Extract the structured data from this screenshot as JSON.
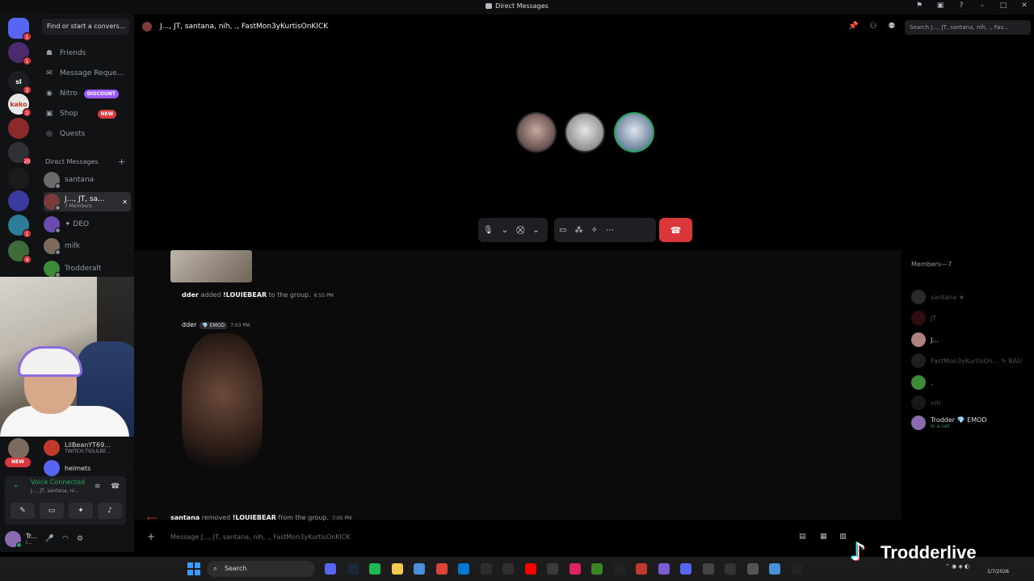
{
  "window": {
    "title": "Direct Messages"
  },
  "guilds": {
    "items": [
      {
        "name": "discord-home",
        "color": "#5865f2",
        "badge": "1",
        "label": ""
      },
      {
        "name": "guild-1",
        "color": "#4a2c6e",
        "badge": "1",
        "label": ""
      },
      {
        "name": "guild-2",
        "color": "#1e1f22",
        "badge": "3",
        "label": "sl"
      },
      {
        "name": "guild-3",
        "color": "#e8e8e8",
        "badge": "2",
        "label": "kako"
      },
      {
        "name": "guild-4",
        "color": "#8a2a2a",
        "badge": "",
        "label": ""
      },
      {
        "name": "guild-5",
        "color": "#2f3136",
        "badge": "20",
        "label": ""
      },
      {
        "name": "guild-6",
        "color": "#1b1b1b",
        "badge": "",
        "label": ""
      },
      {
        "name": "guild-7",
        "color": "#3a3aa0",
        "badge": "",
        "label": ""
      },
      {
        "name": "guild-8",
        "color": "#2d7d9a",
        "badge": "1",
        "label": ""
      },
      {
        "name": "guild-9",
        "color": "#3f6b3a",
        "badge": "4",
        "label": ""
      }
    ],
    "new_badge": "NEW"
  },
  "sidebar": {
    "find_placeholder": "Find or start a convers...",
    "nav": [
      {
        "label": "Friends",
        "icon": "friends-icon",
        "glyph": "☗"
      },
      {
        "label": "Message Reque...",
        "icon": "envelope-icon",
        "glyph": "✉"
      },
      {
        "label": "Nitro",
        "icon": "nitro-icon",
        "glyph": "◉",
        "pill": "DISCOUNT",
        "pill_color": "#9b59ff"
      },
      {
        "label": "Shop",
        "icon": "shop-icon",
        "glyph": "▣",
        "pill": "NEW",
        "pill_color": "#da373c"
      },
      {
        "label": "Quests",
        "icon": "quests-icon",
        "glyph": "◎"
      }
    ],
    "dm_header": "Direct Messages",
    "dms": [
      {
        "label": "santana",
        "sub": "",
        "color": "#6b6b6b"
      },
      {
        "label": "J..., JT, sa...",
        "sub": "7 Members",
        "color": "#7a3b3b",
        "selected": true
      },
      {
        "label": "✦ DEO",
        "sub": "",
        "color": "#6a4bb0"
      },
      {
        "label": "milk",
        "sub": "",
        "color": "#7c6b5c"
      },
      {
        "label": "Trodderalt",
        "sub": "",
        "color": "#3c8a3a"
      }
    ],
    "lower_dms": [
      {
        "l1": "LilBeanYT69...",
        "l2": "TWITCH.TV/LILBE...",
        "color": "#c0392b"
      },
      {
        "l1": "helmets",
        "l2": "",
        "color": "#5865f2"
      }
    ]
  },
  "voice": {
    "status": "Voice Connected",
    "channel": "J..., JT, santana, ni..."
  },
  "user": {
    "name": "Tr...",
    "status": "I..."
  },
  "header": {
    "group_name": "J..., JT, santana, nih, ., FastMon3yKurtisOnKICK",
    "search_placeholder": "Search J..., JT, santana, nih, ., Fas..."
  },
  "chat": {
    "sys1": {
      "actor": "dder",
      "verb": "added",
      "target": "!LOUIEBEAR",
      "tail": "to the group.",
      "time": "6:55 PM"
    },
    "msg": {
      "author": "dder",
      "tag": "EMOD",
      "time": "7:03 PM"
    },
    "sys2": {
      "actor": "santana",
      "verb": "removed",
      "target": "!LOUIEBEAR",
      "tail": "from the group.",
      "time": "7:05 PM"
    },
    "input_placeholder": "Message J..., JT, santana, nih, ., FastMon3yKurtisOnKICK"
  },
  "members": {
    "header": "Members—7",
    "list": [
      {
        "name": "santana ★",
        "sub": "",
        "off": true,
        "color": "#777"
      },
      {
        "name": "JT",
        "sub": "",
        "off": true,
        "color": "#8a1f2a"
      },
      {
        "name": "J...",
        "sub": "",
        "off": false,
        "color": "#b08080"
      },
      {
        "name": "FastMon3yKurtisOn... ✎ BAU",
        "sub": "",
        "off": true,
        "color": "#555"
      },
      {
        "name": ".",
        "sub": "",
        "off": false,
        "color": "#3c8a3a"
      },
      {
        "name": "nih",
        "sub": "",
        "off": true,
        "color": "#444"
      },
      {
        "name": "Trodder  💎 EMOD",
        "sub": "In a call",
        "off": false,
        "color": "#8a6bb0"
      }
    ]
  },
  "taskbar": {
    "search": "Search",
    "date": "1/7/2026"
  },
  "watermark": "Trodderlive"
}
